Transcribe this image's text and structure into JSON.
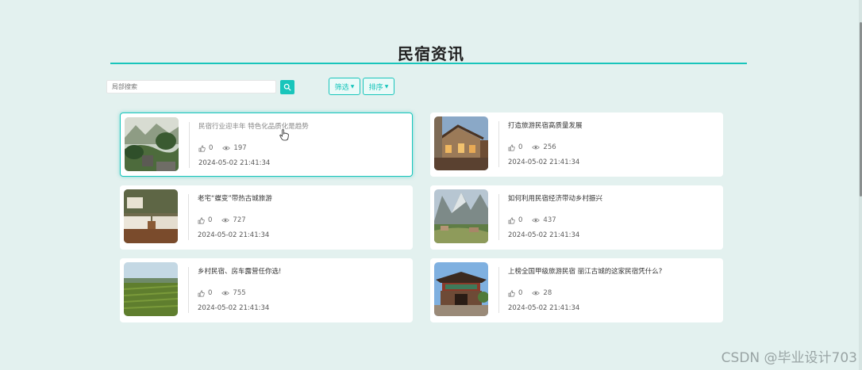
{
  "page": {
    "title": "民宿资讯"
  },
  "toolbar": {
    "search_placeholder": "局部搜索",
    "filter_label": "筛选",
    "sort_label": "排序"
  },
  "news": [
    {
      "title": "民宿行业迎丰年 特色化品质化是趋势",
      "likes": "0",
      "views": "197",
      "date": "2024-05-02 21:41:34",
      "thumb": "mountain-garden"
    },
    {
      "title": "打造旅游民宿高质量发展",
      "likes": "0",
      "views": "256",
      "date": "2024-05-02 21:41:34",
      "thumb": "stone-house"
    },
    {
      "title": "老宅“蝶变”带热古城旅游",
      "likes": "0",
      "views": "727",
      "date": "2024-05-02 21:41:34",
      "thumb": "bedroom"
    },
    {
      "title": "如何利用民宿经济带动乡村振兴",
      "likes": "0",
      "views": "437",
      "date": "2024-05-02 21:41:34",
      "thumb": "valley-village"
    },
    {
      "title": "乡村民宿、房车露营任你选!",
      "likes": "0",
      "views": "755",
      "date": "2024-05-02 21:41:34",
      "thumb": "rice-field"
    },
    {
      "title": "上榜全国甲级旅游民宿 丽江古城的这家民宿凭什么?",
      "likes": "0",
      "views": "28",
      "date": "2024-05-02 21:41:34",
      "thumb": "ancient-gate"
    }
  ],
  "watermark": "CSDN @毕业设计703"
}
